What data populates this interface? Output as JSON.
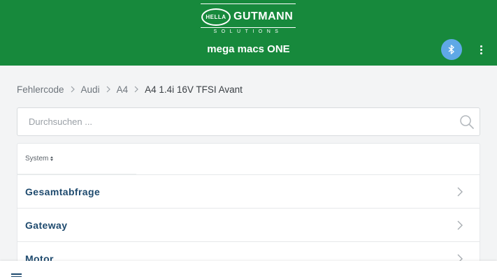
{
  "header": {
    "logo": {
      "badge": "HELLA",
      "brand": "GUTMANN",
      "subtitle": "SOLUTIONS"
    },
    "title": "mega macs ONE",
    "bluetooth_icon": "bluetooth-icon",
    "more_icon": "more-vertical-icon"
  },
  "breadcrumb": [
    "Fehlercode",
    "Audi",
    "A4",
    "A4 1.4i 16V TFSI Avant"
  ],
  "search": {
    "placeholder": "Durchsuchen ...",
    "value": ""
  },
  "list": {
    "sort_label": "System",
    "items": [
      {
        "label": "Gesamtabfrage"
      },
      {
        "label": "Gateway"
      },
      {
        "label": "Motor"
      }
    ]
  },
  "bottom_bar": {
    "menu_icon": "hamburger-menu-icon"
  },
  "colors": {
    "header_bg": "#17893c",
    "accent_blue": "#5fa8e6",
    "item_text": "#1e4a6e",
    "page_bg": "#f3f4f5"
  }
}
